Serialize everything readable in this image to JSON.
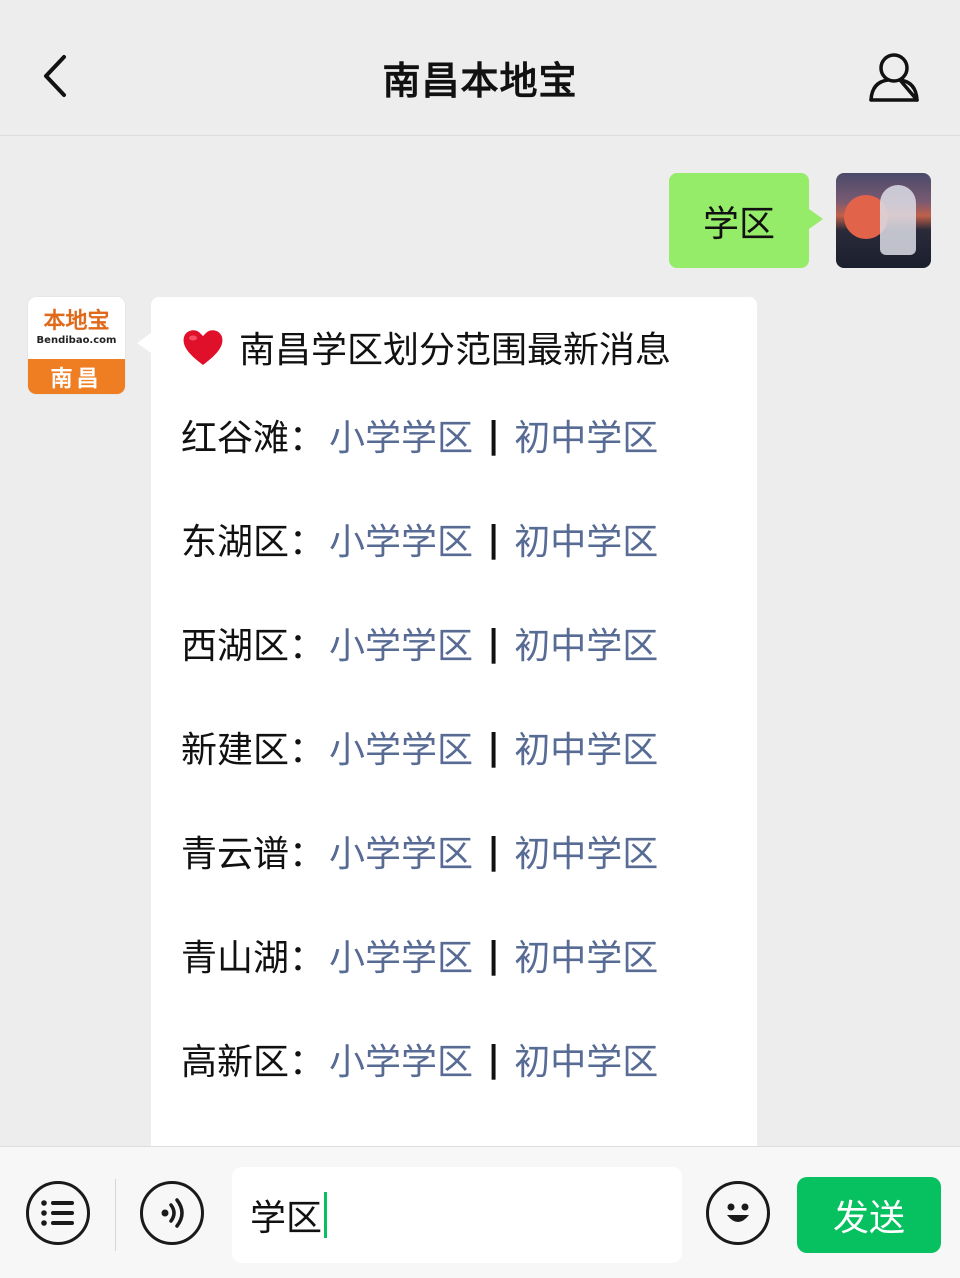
{
  "header": {
    "title": "南昌本地宝",
    "back_icon": "chevron-left-icon",
    "profile_icon": "user-icon"
  },
  "messages": {
    "outgoing": {
      "text": "学区"
    },
    "incoming": {
      "avatar": {
        "name": "本地宝",
        "domain": "Bendibao.com",
        "city": "南昌"
      },
      "title": "南昌学区划分范围最新消息",
      "rows": [
        {
          "district": "红谷滩",
          "primary": "小学学区",
          "separator": "|",
          "middle": "初中学区"
        },
        {
          "district": "东湖区",
          "primary": "小学学区",
          "separator": "|",
          "middle": "初中学区"
        },
        {
          "district": "西湖区",
          "primary": "小学学区",
          "separator": "|",
          "middle": "初中学区"
        },
        {
          "district": "新建区",
          "primary": "小学学区",
          "separator": "|",
          "middle": "初中学区"
        },
        {
          "district": "青云谱",
          "primary": "小学学区",
          "separator": "|",
          "middle": "初中学区"
        },
        {
          "district": "青山湖",
          "primary": "小学学区",
          "separator": "|",
          "middle": "初中学区"
        },
        {
          "district": "高新区",
          "primary": "小学学区",
          "separator": "|",
          "middle": "初中学区"
        }
      ],
      "colon": "："
    }
  },
  "input_bar": {
    "value": "学区",
    "send_label": "发送"
  },
  "colors": {
    "link": "#576b95",
    "outgoing_bubble": "#95ec69",
    "send_button": "#07c160"
  }
}
